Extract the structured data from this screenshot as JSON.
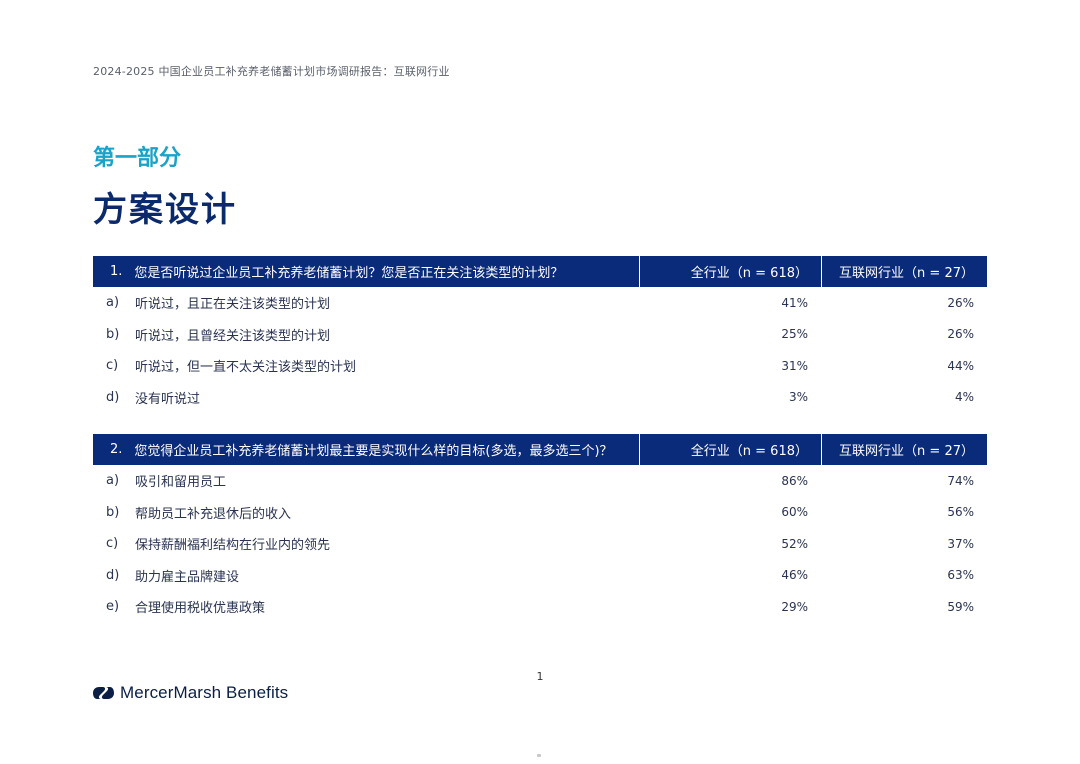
{
  "header": {
    "running_title": "2024-2025 中国企业员工补充养老储蓄计划市场调研报告：互联网行业"
  },
  "section": {
    "kicker": "第一部分",
    "title": "方案设计"
  },
  "columns": {
    "all": "全行业（n = 618）",
    "internet": "互联网行业（n = 27）"
  },
  "questions": [
    {
      "num": "1.",
      "text": "您是否听说过企业员工补充养老储蓄计划？您是否正在关注该类型的计划？",
      "rows": [
        {
          "letter": "a)",
          "label": "听说过，且正在关注该类型的计划",
          "all": "41%",
          "internet": "26%"
        },
        {
          "letter": "b)",
          "label": "听说过，且曾经关注该类型的计划",
          "all": "25%",
          "internet": "26%"
        },
        {
          "letter": "c)",
          "label": "听说过，但一直不太关注该类型的计划",
          "all": "31%",
          "internet": "44%"
        },
        {
          "letter": "d)",
          "label": "没有听说过",
          "all": "3%",
          "internet": "4%"
        }
      ]
    },
    {
      "num": "2.",
      "text": "您觉得企业员工补充养老储蓄计划最主要是实现什么样的目标(多选，最多选三个)？",
      "rows": [
        {
          "letter": "a)",
          "label": "吸引和留用员工",
          "all": "86%",
          "internet": "74%"
        },
        {
          "letter": "b)",
          "label": "帮助员工补充退休后的收入",
          "all": "60%",
          "internet": "56%"
        },
        {
          "letter": "c)",
          "label": "保持薪酬福利结构在行业内的领先",
          "all": "52%",
          "internet": "37%"
        },
        {
          "letter": "d)",
          "label": "助力雇主品牌建设",
          "all": "46%",
          "internet": "63%"
        },
        {
          "letter": "e)",
          "label": "合理使用税收优惠政策",
          "all": "29%",
          "internet": "59%"
        }
      ]
    }
  ],
  "footer": {
    "page_number": "1",
    "logo_text": "MercerMarsh Benefits",
    "logo_icon": "mercer-marsh-logo-icon",
    "brand_color": "#0b1f45"
  },
  "colors": {
    "header_band": "#0a2a7a",
    "kicker": "#1aa3c8",
    "title": "#0b2a6b"
  }
}
